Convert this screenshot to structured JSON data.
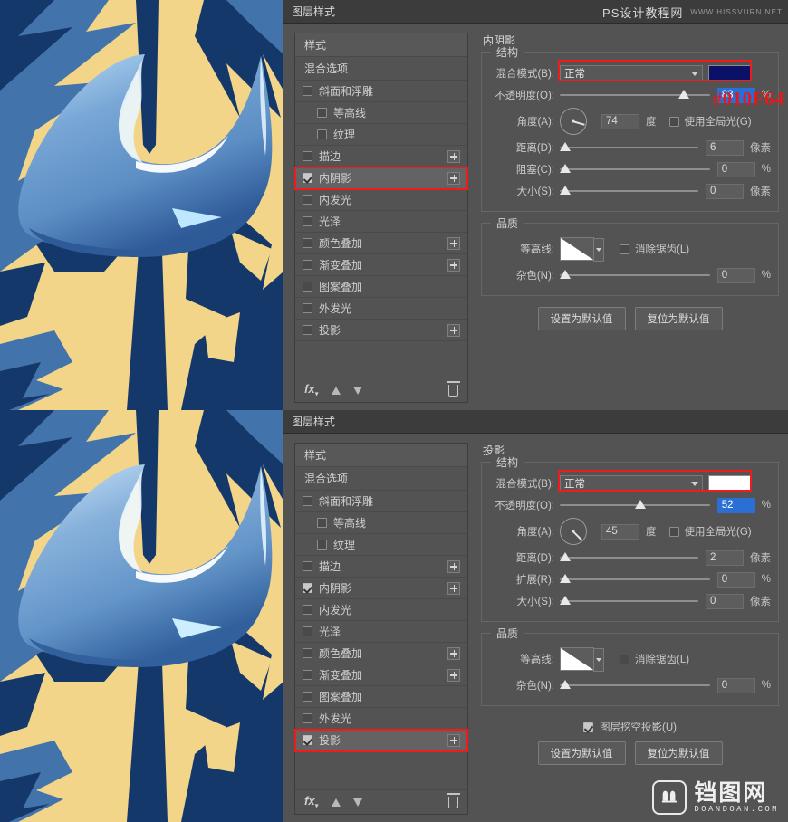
{
  "watermark": {
    "site_cn": "PS设计教程网",
    "site_en": "WWW.HISSVURN.NET",
    "logo_cn": "铛图网",
    "logo_en": "DOANDOAN.COM"
  },
  "dialog_title": "图层样式",
  "styles_panel": {
    "header": "样式",
    "blending_options": "混合选项",
    "items": [
      {
        "label": "斜面和浮雕",
        "checked": false,
        "indent": false,
        "plus": false
      },
      {
        "label": "等高线",
        "checked": false,
        "indent": true,
        "plus": false
      },
      {
        "label": "纹理",
        "checked": false,
        "indent": true,
        "plus": false
      },
      {
        "label": "描边",
        "checked": false,
        "indent": false,
        "plus": true
      },
      {
        "label": "内阴影",
        "checked": true,
        "indent": false,
        "plus": true
      },
      {
        "label": "内发光",
        "checked": false,
        "indent": false,
        "plus": false
      },
      {
        "label": "光泽",
        "checked": false,
        "indent": false,
        "plus": false
      },
      {
        "label": "颜色叠加",
        "checked": false,
        "indent": false,
        "plus": true
      },
      {
        "label": "渐变叠加",
        "checked": false,
        "indent": false,
        "plus": true
      },
      {
        "label": "图案叠加",
        "checked": false,
        "indent": false,
        "plus": false
      },
      {
        "label": "外发光",
        "checked": false,
        "indent": false,
        "plus": false
      },
      {
        "label": "投影",
        "checked": false,
        "indent": false,
        "plus": true
      }
    ]
  },
  "top_dialog": {
    "effect_title": "内阴影",
    "structure_label": "结构",
    "quality_label": "品质",
    "blend_mode_label": "混合模式(B):",
    "blend_mode_value": "正常",
    "color_hex": "#010F64",
    "opacity_label": "不透明度(O):",
    "opacity_value": "83",
    "opacity_unit": "%",
    "angle_label": "角度(A):",
    "angle_value": "74",
    "angle_unit": "度",
    "use_global_light": "使用全局光(G)",
    "distance_label": "距离(D):",
    "distance_value": "6",
    "distance_unit": "像素",
    "choke_label": "阻塞(C):",
    "choke_value": "0",
    "choke_unit": "%",
    "size_label": "大小(S):",
    "size_value": "0",
    "size_unit": "像素",
    "contour_label": "等高线:",
    "antialias_label": "消除锯齿(L)",
    "noise_label": "杂色(N):",
    "noise_value": "0",
    "noise_unit": "%",
    "set_default_btn": "设置为默认值",
    "reset_default_btn": "复位为默认值",
    "annotation": "#010F64",
    "highlighted_style": "内阴影"
  },
  "bottom_dialog": {
    "effect_title": "投影",
    "structure_label": "结构",
    "quality_label": "品质",
    "blend_mode_label": "混合模式(B):",
    "blend_mode_value": "正常",
    "color_hex": "#FFFFFF",
    "opacity_label": "不透明度(O):",
    "opacity_value": "52",
    "opacity_unit": "%",
    "angle_label": "角度(A):",
    "angle_value": "45",
    "angle_unit": "度",
    "use_global_light": "使用全局光(G)",
    "distance_label": "距离(D):",
    "distance_value": "2",
    "distance_unit": "像素",
    "spread_label": "扩展(R):",
    "spread_value": "0",
    "spread_unit": "%",
    "size_label": "大小(S):",
    "size_value": "0",
    "size_unit": "像素",
    "contour_label": "等高线:",
    "antialias_label": "消除锯齿(L)",
    "noise_label": "杂色(N):",
    "noise_value": "0",
    "noise_unit": "%",
    "knockout_label": "图层挖空投影(U)",
    "knockout_checked": true,
    "set_default_btn": "设置为默认值",
    "reset_default_btn": "复位为默认值",
    "highlighted_style": "投影"
  },
  "colors": {
    "accent_red": "#ee1c1c",
    "inner_shadow_color": "#010f64",
    "drop_shadow_color": "#ffffff",
    "art_gold": "#f3d589",
    "art_navy": "#15386b",
    "art_blue": "#3f6ea8",
    "art_crescent": "#6b9fd4"
  }
}
